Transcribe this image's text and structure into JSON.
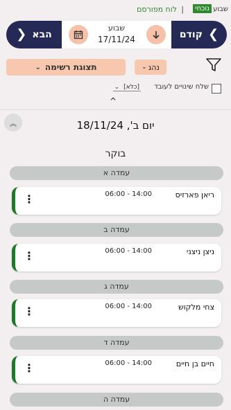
{
  "top_links": {
    "week": "שבוע",
    "current": "נוכחי",
    "separator": "|",
    "published": "לוח מפורסם"
  },
  "nav": {
    "prev_label": "קודם",
    "next_label": "הבא",
    "week_label": "שבוע",
    "week_date": "17/11/24"
  },
  "filters": {
    "driver_label": "נהג",
    "list_view_label": "תצוגת רשימה"
  },
  "send_changes": {
    "label": "שלח שינויים לעובד",
    "select_value": "[כלא]"
  },
  "day": {
    "title": "יום ב', 18/11/24",
    "period": "בוקר"
  },
  "stations": [
    {
      "label": "עמדה א",
      "shift": {
        "name": "ריאן פארזיס",
        "time": "06:00 - 14:00"
      }
    },
    {
      "label": "עמדה ב",
      "shift": {
        "name": "ניצן ניצני",
        "time": "06:00 - 14:00"
      }
    },
    {
      "label": "עמדה ג",
      "shift": {
        "name": "צחי מלקוש",
        "time": "06:00 - 14:00"
      }
    },
    {
      "label": "עמדה ד",
      "shift": {
        "name": "חיים בן חיים",
        "time": "06:00 - 14:00"
      }
    },
    {
      "label": "עמדה ה"
    }
  ],
  "colors": {
    "nav_bg": "#242a55",
    "accent_peach": "#f7c7ae",
    "green": "#2f8a2f",
    "card_bar": "#1e7a2a"
  }
}
